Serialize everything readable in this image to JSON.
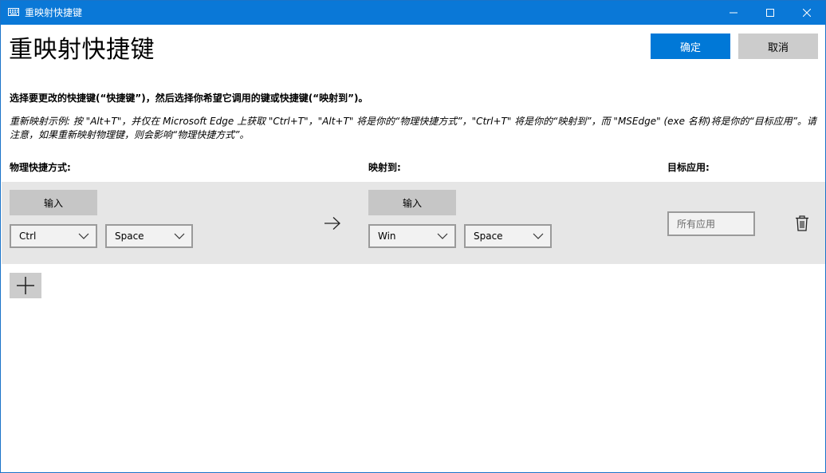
{
  "window": {
    "title": "重映射快捷键",
    "title_bar_color": "#0a78d7"
  },
  "header": {
    "title": "重映射快捷键",
    "ok_label": "确定",
    "cancel_label": "取消",
    "accent_color": "#0078d7"
  },
  "instructions": {
    "main": "选择要更改的快捷键(“快捷键”)，然后选择你希望它调用的键或快捷键(“映射到”)。",
    "example": "重新映射示例: 按 \"Alt+T\"，并仅在 Microsoft Edge 上获取 \"Ctrl+T\"，\"Alt+T\" 将是你的“物理快捷方式”，\"Ctrl+T\" 将是你的“映射到”，而 \"MSEdge\" (exe 名称)将是你的“目标应用”。请注意，如果重新映射物理键，则会影响“物理快捷方式”。"
  },
  "columns": {
    "physical": "物理快捷方式:",
    "mapped": "映射到:",
    "target": "目标应用:"
  },
  "row": {
    "physical_type_label": "输入",
    "physical_keys": [
      "Ctrl",
      "Space"
    ],
    "mapped_type_label": "输入",
    "mapped_keys": [
      "Win",
      "Space"
    ],
    "target_placeholder": "所有应用"
  },
  "icons": {
    "app": "keyboard-icon",
    "minimize": "minimize-icon",
    "maximize": "maximize-icon",
    "close": "close-icon",
    "arrow": "arrow-right-icon",
    "delete": "trash-icon",
    "add": "plus-icon",
    "dropdown": "chevron-down-icon"
  }
}
